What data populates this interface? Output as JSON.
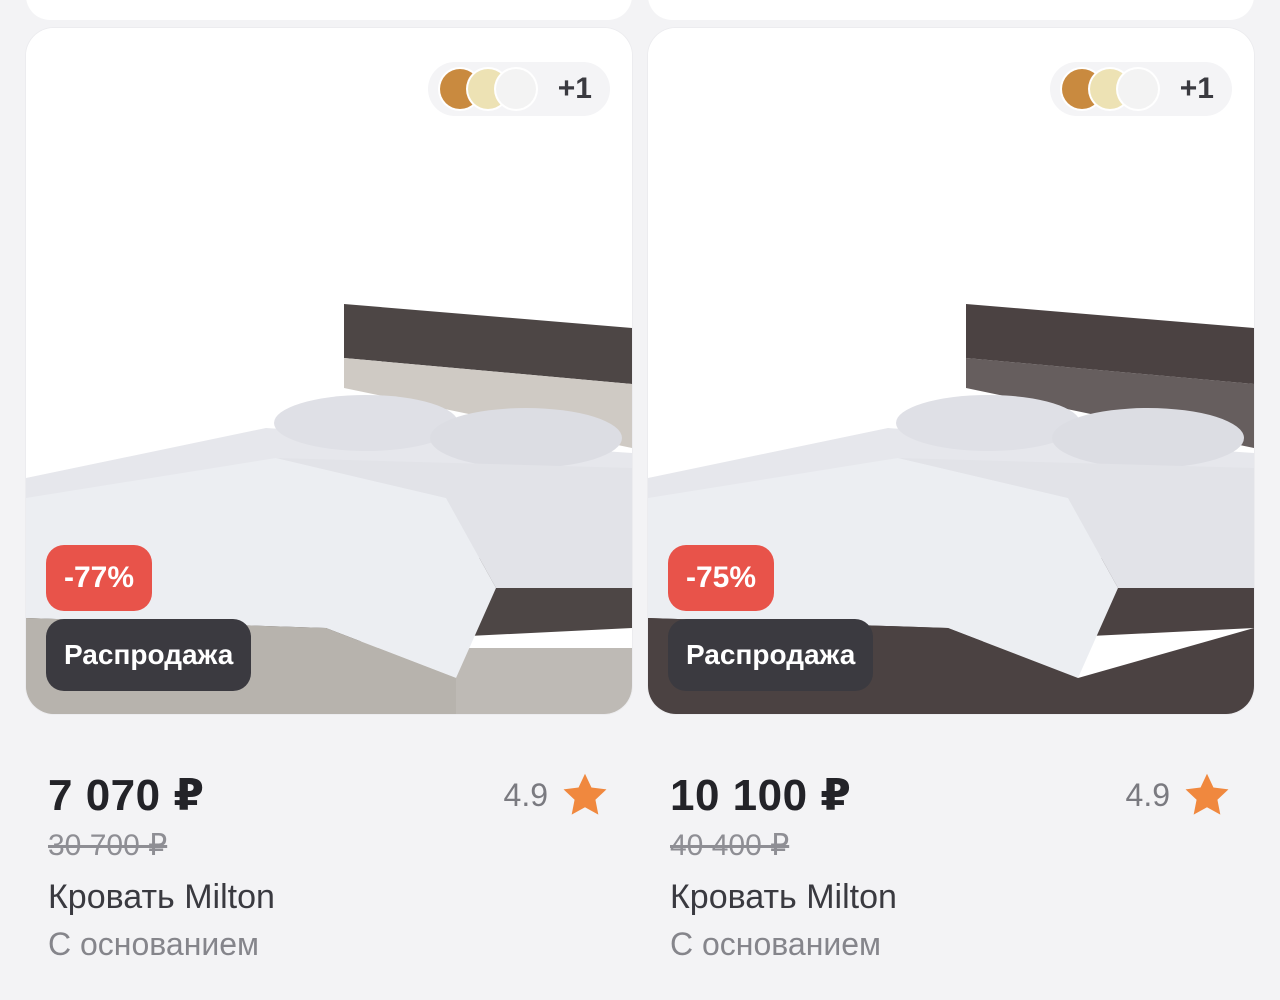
{
  "products": [
    {
      "swatch_more": "+1",
      "swatch_colors": [
        "#c98a3f",
        "#ede2b4",
        "#f3f3f3"
      ],
      "wood_color": "#4d4645",
      "side_color": "#b7b3ad",
      "discount": "-77%",
      "badge": "Распродажа",
      "price": "7 070 ₽",
      "old_price": "30 700 ₽",
      "rating": "4.9",
      "name": "Кровать Milton",
      "subtitle": "С основанием"
    },
    {
      "swatch_more": "+1",
      "swatch_colors": [
        "#c98a3f",
        "#ede2b4",
        "#f3f3f3"
      ],
      "wood_color": "#4b4242",
      "side_color": "#4b4242",
      "discount": "-75%",
      "badge": "Распродажа",
      "price": "10 100 ₽",
      "old_price": "40 400 ₽",
      "rating": "4.9",
      "name": "Кровать Milton",
      "subtitle": "С основанием"
    }
  ],
  "colors": {
    "discount_badge": "#e8534a",
    "sale_badge": "#3b3a40",
    "star": "#f0883e"
  }
}
